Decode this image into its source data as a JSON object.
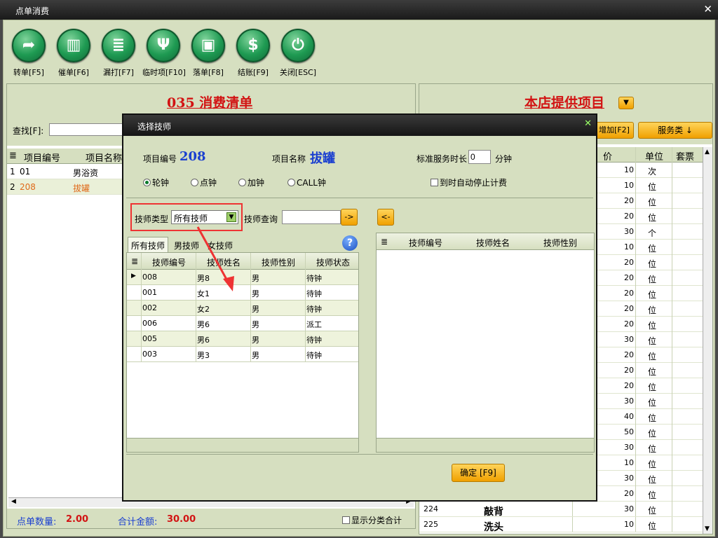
{
  "window": {
    "title": "点单消费"
  },
  "toolbar": {
    "buttons": [
      {
        "label": "转单[F5]",
        "glyph": "➦"
      },
      {
        "label": "催单[F6]",
        "glyph": "▥"
      },
      {
        "label": "漏打[F7]",
        "glyph": "≣"
      },
      {
        "label": "临时项[F10]",
        "glyph": "Ψ"
      },
      {
        "label": "落单[F8]",
        "glyph": "▣"
      },
      {
        "label": "结账[F9]",
        "glyph": "$"
      },
      {
        "label": "关闭[ESC]",
        "glyph": "⏻"
      }
    ]
  },
  "left": {
    "title": "035 消费清单",
    "search_label": "查找[F]:",
    "columns": [
      "项目编号",
      "项目名称"
    ],
    "rows": [
      {
        "idx": "1",
        "code": "01",
        "name": "男浴资"
      },
      {
        "idx": "2",
        "code": "208",
        "name": "拔罐"
      }
    ],
    "footer": {
      "qty_label": "点单数量:",
      "qty": "2.00",
      "total_label": "合计金额:",
      "total": "30.00",
      "show_cat": "显示分类合计"
    }
  },
  "right": {
    "title": "本店提供项目",
    "add_btn": "增加[F2]",
    "category_btn": "服务类 ↓",
    "columns": [
      "价",
      "单位",
      "套票"
    ],
    "rows": [
      {
        "price": "10",
        "unit": "次"
      },
      {
        "price": "10",
        "unit": "位"
      },
      {
        "price": "20",
        "unit": "位"
      },
      {
        "price": "20",
        "unit": "位"
      },
      {
        "price": "30",
        "unit": "个"
      },
      {
        "price": "10",
        "unit": "位"
      },
      {
        "price": "20",
        "unit": "位"
      },
      {
        "price": "20",
        "unit": "位"
      },
      {
        "price": "20",
        "unit": "位"
      },
      {
        "price": "20",
        "unit": "位"
      },
      {
        "price": "20",
        "unit": "位"
      },
      {
        "price": "30",
        "unit": "位"
      },
      {
        "price": "20",
        "unit": "位"
      },
      {
        "price": "20",
        "unit": "位"
      },
      {
        "price": "20",
        "unit": "位"
      },
      {
        "price": "30",
        "unit": "位"
      },
      {
        "price": "40",
        "unit": "位"
      },
      {
        "price": "50",
        "unit": "位"
      },
      {
        "price": "30",
        "unit": "位"
      },
      {
        "price": "10",
        "unit": "位"
      },
      {
        "price": "30",
        "unit": "位"
      },
      {
        "price": "20",
        "unit": "位"
      }
    ],
    "bottom_rows": [
      {
        "code": "224",
        "name": "敲背",
        "price": "30",
        "unit": "位"
      },
      {
        "code": "225",
        "name": "洗头",
        "price": "10",
        "unit": "位"
      }
    ]
  },
  "dialog": {
    "title": "选择技师",
    "item_code_label": "项目编号",
    "item_code": "208",
    "item_name_label": "项目名称",
    "item_name": "拔罐",
    "duration_label": "标准服务时长",
    "duration": "0",
    "duration_unit": "分钟",
    "modes": [
      "轮钟",
      "点钟",
      "加钟",
      "CALL钟"
    ],
    "auto_stop": "到时自动停止计费",
    "tech_type_label": "技师类型",
    "tech_type_value": "所有技师",
    "tech_query_label": "技师查询",
    "tabs": [
      "所有技师",
      "男技师",
      "女技师"
    ],
    "columns": [
      "技师编号",
      "技师姓名",
      "技师性别",
      "技师状态"
    ],
    "rows": [
      {
        "code": "008",
        "name": "男8",
        "gender": "男",
        "status": "待钟"
      },
      {
        "code": "001",
        "name": "女1",
        "gender": "男",
        "status": "待钟"
      },
      {
        "code": "002",
        "name": "女2",
        "gender": "男",
        "status": "待钟"
      },
      {
        "code": "006",
        "name": "男6",
        "gender": "男",
        "status": "派工"
      },
      {
        "code": "005",
        "name": "男6",
        "gender": "男",
        "status": "待钟"
      },
      {
        "code": "003",
        "name": "男3",
        "gender": "男",
        "status": "待钟"
      }
    ],
    "right_columns": [
      "技师编号",
      "技师姓名",
      "技师性别"
    ],
    "confirm": "确定 [F9]"
  }
}
